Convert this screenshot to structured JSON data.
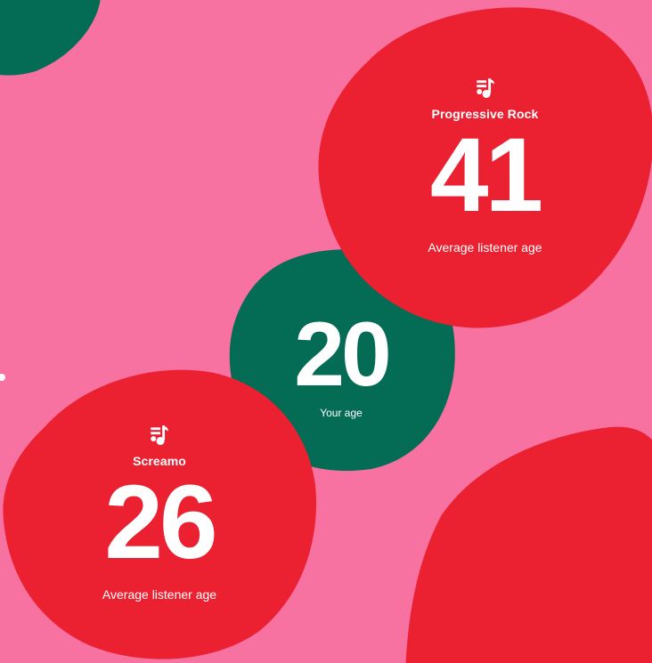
{
  "colors": {
    "background": "#f771a1",
    "red": "#eb2030",
    "green": "#046b55",
    "text": "#ffffff"
  },
  "icons": {
    "genre_icon": "music-note-icon"
  },
  "cards": {
    "progressive_rock": {
      "genre": "Progressive Rock",
      "age": "41",
      "caption": "Average listener age"
    },
    "user": {
      "age": "20",
      "caption": "Your age"
    },
    "screamo": {
      "genre": "Screamo",
      "age": "26",
      "caption": "Average listener age"
    }
  }
}
